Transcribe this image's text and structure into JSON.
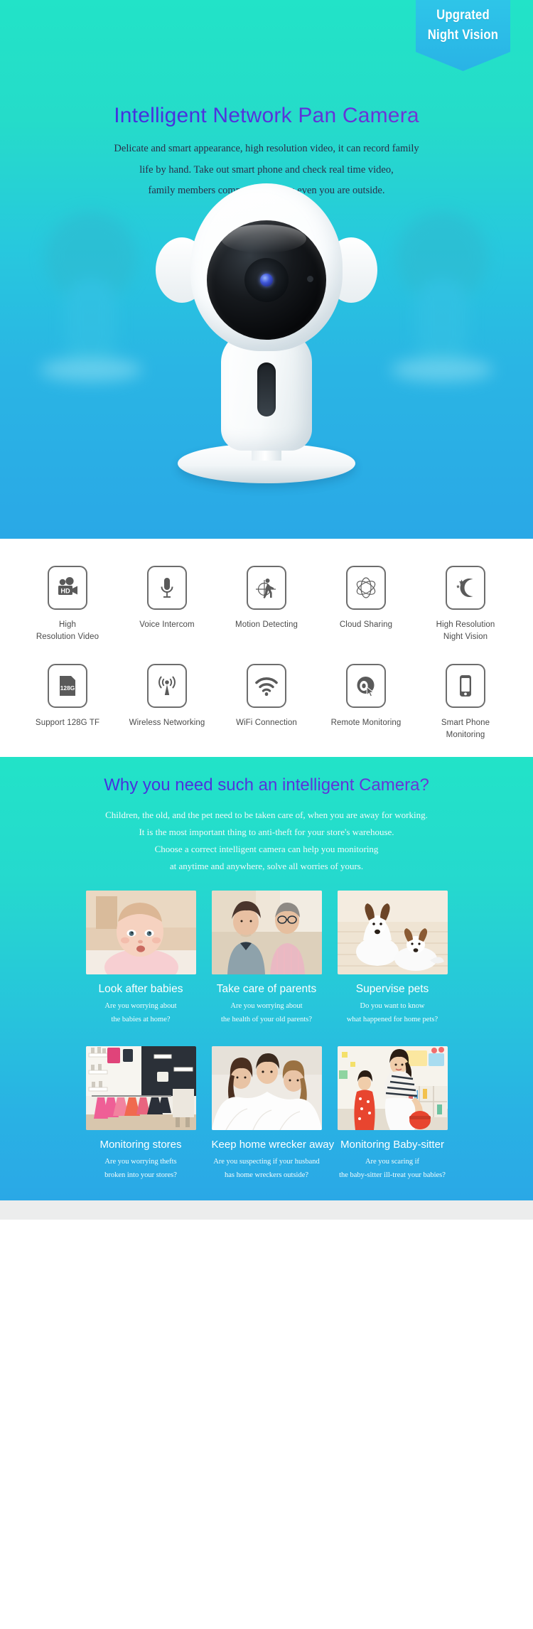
{
  "hero": {
    "ribbon_line1": "Upgrated",
    "ribbon_line2": "Night Vision",
    "title": "Intelligent Network Pan Camera",
    "desc_line1": "Delicate and smart appearance, high resolution video, it can record family",
    "desc_line2": "life by hand. Take out smart phone and check real time video,",
    "desc_line3": "family members company with you even you are outside.",
    "accent_teal": "#22e3c8",
    "accent_blue": "#2aa8e6",
    "title_color": "#4a32dd"
  },
  "features": {
    "row1": [
      {
        "icon": "hd-camcorder-icon",
        "label_line1": "High",
        "label_line2": "Resolution Video"
      },
      {
        "icon": "microphone-icon",
        "label_line1": "Voice Intercom",
        "label_line2": ""
      },
      {
        "icon": "motion-detect-icon",
        "label_line1": "Motion Detecting",
        "label_line2": ""
      },
      {
        "icon": "atom-cloud-icon",
        "label_line1": "Cloud Sharing",
        "label_line2": ""
      },
      {
        "icon": "moon-stars-icon",
        "label_line1": "High Resolution",
        "label_line2": "Night Vision"
      }
    ],
    "row2": [
      {
        "icon": "sd-card-icon",
        "label_line1": "Support 128G TF",
        "label_line2": "",
        "badge": "128G"
      },
      {
        "icon": "antenna-icon",
        "label_line1": "Wireless Networking",
        "label_line2": ""
      },
      {
        "icon": "wifi-icon",
        "label_line1": "WiFi Connection",
        "label_line2": ""
      },
      {
        "icon": "lens-cursor-icon",
        "label_line1": "Remote Monitoring",
        "label_line2": ""
      },
      {
        "icon": "smartphone-icon",
        "label_line1": "Smart Phone",
        "label_line2": "Monitoring"
      }
    ]
  },
  "why": {
    "title": "Why you need such an intelligent Camera?",
    "desc_line1": "Children, the old, and the pet need to be taken care of, when you are away for working.",
    "desc_line2": "It is the most important thing to anti-theft for your store's warehouse.",
    "desc_line3": "Choose a correct intelligent camera can help you monitoring",
    "desc_line4": "at anytime and anywhere, solve all worries of yours.",
    "cards_row1": [
      {
        "photo": "baby-photo",
        "title": "Look after babies",
        "sub_line1": "Are you worrying about",
        "sub_line2": "the babies at home?"
      },
      {
        "photo": "elderly-couple-photo",
        "title": "Take care of parents",
        "sub_line1": "Are you worrying about",
        "sub_line2": "the health of your old parents?"
      },
      {
        "photo": "dogs-photo",
        "title": "Supervise pets",
        "sub_line1": "Do you want to know",
        "sub_line2": "what happened for home pets?"
      }
    ],
    "cards_row2": [
      {
        "photo": "clothing-store-photo",
        "title": "Monitoring stores",
        "sub_line1": "Are you worrying thefts",
        "sub_line2": "broken into your stores?"
      },
      {
        "photo": "bedroom-couple-photo",
        "title": "Keep home wrecker away",
        "sub_line1": "Are you suspecting if your husband",
        "sub_line2": "has home wreckers outside?"
      },
      {
        "photo": "babysitter-photo",
        "title": "Monitoring Baby-sitter",
        "sub_line1": "Are you scaring if",
        "sub_line2": "the baby-sitter ill-treat your babies?"
      }
    ]
  }
}
